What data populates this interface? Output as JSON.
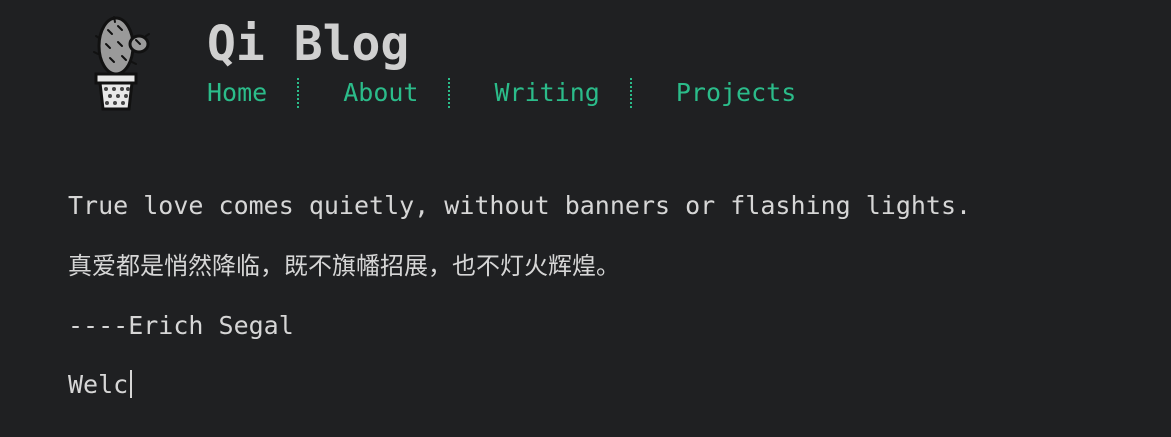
{
  "header": {
    "title": "Qi Blog",
    "logo_icon": "cactus-icon"
  },
  "nav": {
    "items": [
      {
        "label": "Home"
      },
      {
        "label": "About"
      },
      {
        "label": "Writing"
      },
      {
        "label": "Projects"
      }
    ]
  },
  "main": {
    "quote_en": "True love comes quietly, without banners or flashing lights.",
    "quote_cn": "真爱都是悄然降临，既不旗幡招展，也不灯火辉煌。",
    "attribution": "----Erich Segal",
    "typed_text": "Welc"
  },
  "colors": {
    "background": "#1f2022",
    "text": "#d6d6d6",
    "accent": "#2bbc8a"
  }
}
